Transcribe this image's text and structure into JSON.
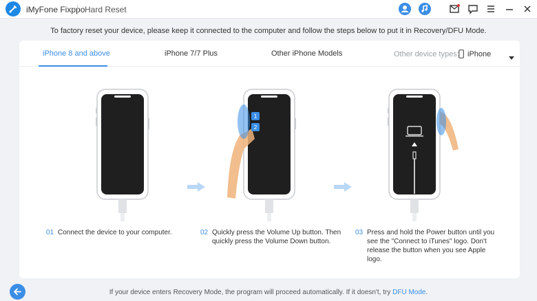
{
  "app": {
    "name": "iMyFone Fixppo",
    "page": "Hard Reset"
  },
  "header": {
    "icons": [
      "user-icon",
      "music-search-icon",
      "mail-icon",
      "feedback-icon",
      "menu-icon",
      "minimize-icon",
      "close-icon"
    ]
  },
  "instruction": "To factory reset your device, please keep it connected to the computer and follow the steps below to put it in Recovery/DFU Mode.",
  "tabs": [
    {
      "label": "iPhone 8 and above",
      "active": true
    },
    {
      "label": "iPhone 7/7 Plus"
    },
    {
      "label": "Other iPhone Models"
    }
  ],
  "device_selector": {
    "label": "Other device types:",
    "value": "iPhone"
  },
  "steps": [
    {
      "num": "01",
      "text": "Connect the device to your computer."
    },
    {
      "num": "02",
      "text": "Quickly press the Volume Up button. Then quickly press the Volume Down button."
    },
    {
      "num": "03",
      "text": "Press and hold the Power button until you see the \"Connect to iTunes\" logo. Don't release the button when you see Apple logo."
    }
  ],
  "footer": {
    "text": "If your device enters Recovery Mode, the program will proceed automatically. If it doesn't, try",
    "link": "DFU Mode",
    "end": "."
  },
  "colors": {
    "accent": "#3a8ee6",
    "phone_screen": "#1f1f1f",
    "arrow": "#b9d7f5",
    "finger": "#f0b37a"
  }
}
